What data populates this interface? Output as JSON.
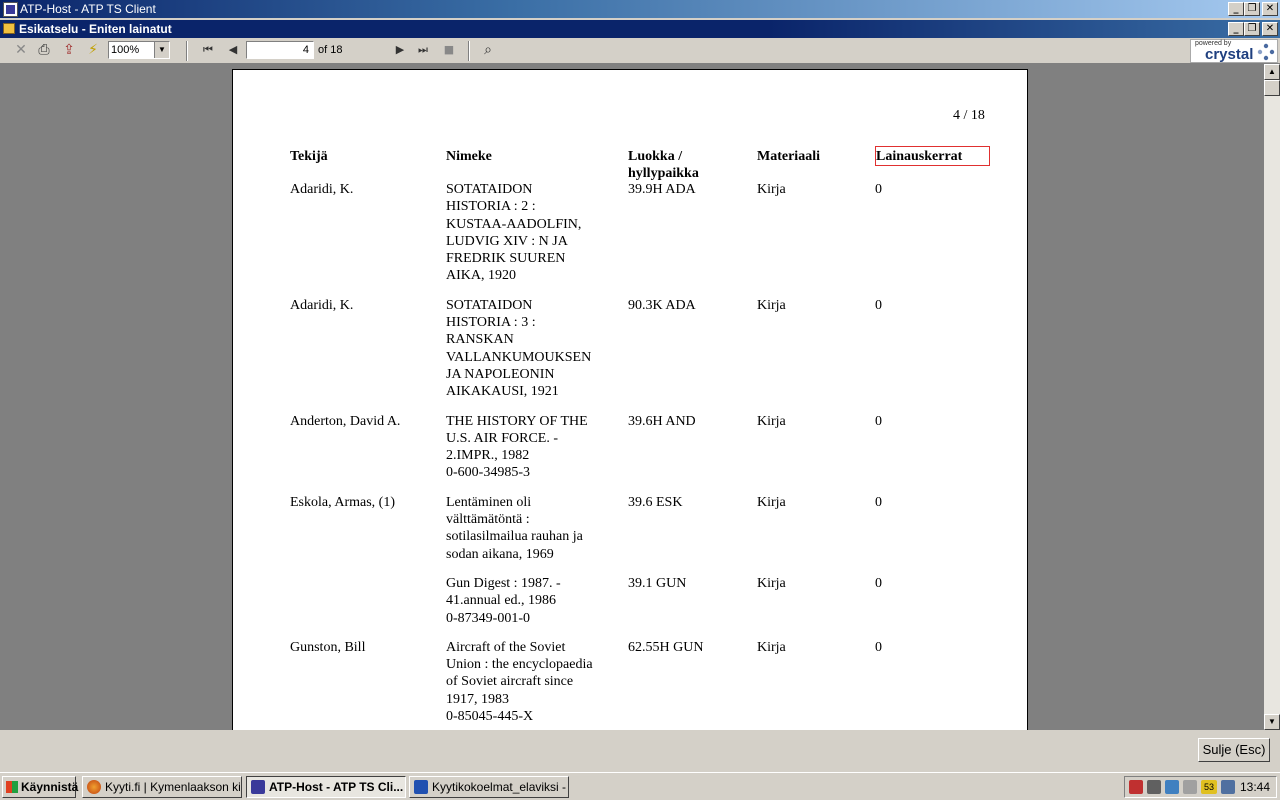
{
  "outer_window": {
    "title": "ATP-Host - ATP TS Client"
  },
  "inner_window": {
    "title": "Esikatselu - Eniten lainatut"
  },
  "toolbar": {
    "zoom": "100%",
    "current_page": "4",
    "of_pages": "of 18",
    "brand_small": "powered by",
    "brand": "crystal"
  },
  "report": {
    "page_label": "4 / 18",
    "headers": [
      "Tekijä",
      "Nimeke",
      "Luokka /",
      "hyllypaikka",
      "Materiaali",
      "Lainauskerrat"
    ],
    "rows": [
      {
        "author": "Adaridi, K.",
        "title": [
          "SOTATAIDON",
          "HISTORIA : 2 :",
          "KUSTAA-AADOLFIN,",
          "LUDVIG XIV : N JA",
          "FREDRIK SUUREN",
          "AIKA, 1920"
        ],
        "class": "39.9H ADA",
        "material": "Kirja",
        "loans": "0"
      },
      {
        "author": "Adaridi, K.",
        "title": [
          "SOTATAIDON",
          "HISTORIA : 3 :",
          "RANSKAN",
          "VALLANKUMOUKSEN",
          "JA NAPOLEONIN",
          "AIKAKAUSI, 1921"
        ],
        "class": "90.3K ADA",
        "material": "Kirja",
        "loans": "0"
      },
      {
        "author": "Anderton, David A.",
        "title": [
          "THE HISTORY OF THE",
          "U.S. AIR FORCE. -",
          "2.IMPR., 1982",
          "0-600-34985-3"
        ],
        "class": "39.6H AND",
        "material": "Kirja",
        "loans": "0"
      },
      {
        "author": "Eskola, Armas, (1)",
        "title": [
          "Lentäminen oli",
          "välttämätöntä :",
          "sotilasilmailua rauhan ja",
          "sodan aikana, 1969"
        ],
        "class": "39.6 ESK",
        "material": "Kirja",
        "loans": "0"
      },
      {
        "author": "",
        "title": [
          "Gun Digest : 1987. -",
          "41.annual ed., 1986",
          "0-87349-001-0"
        ],
        "class": "39.1 GUN",
        "material": "Kirja",
        "loans": "0"
      },
      {
        "author": "Gunston, Bill",
        "title": [
          "Aircraft of the Soviet",
          "Union : the encyclopaedia",
          "of Soviet aircraft since",
          "1917, 1983",
          "0-85045-445-X"
        ],
        "class": "62.55H GUN",
        "material": "Kirja",
        "loans": "0"
      }
    ]
  },
  "bottom": {
    "close_button": "Sulje (Esc)"
  },
  "taskbar": {
    "start": "Käynnistä",
    "tasks": [
      "Kyyti.fi | Kymenlaakson ki...",
      "ATP-Host - ATP TS Cli...",
      "Kyytikokoelmat_elaviksi - ..."
    ],
    "clock": "13:44",
    "tray_label": "53"
  }
}
